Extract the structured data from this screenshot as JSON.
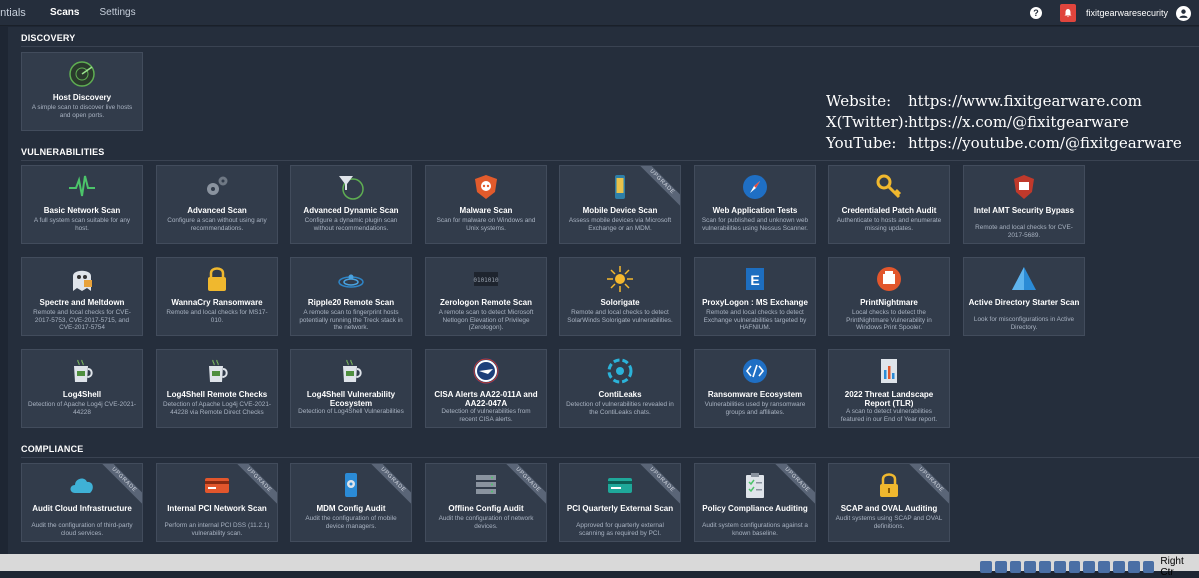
{
  "topbar": {
    "brand": "entials",
    "tabs": [
      "Scans",
      "Settings"
    ],
    "help": "?",
    "username": "fixitgearwaresecurity"
  },
  "overlay": {
    "lines": [
      {
        "label": "Website:",
        "value": "https://www.fixitgearware.com"
      },
      {
        "label": "X(Twitter):",
        "value": "https://x.com/@fixitgearware"
      },
      {
        "label": "YouTube:",
        "value": "https://youtube.com/@fixitgearware"
      }
    ]
  },
  "upgrade_label": "UPGRADE",
  "sections": [
    {
      "title": "DISCOVERY",
      "cards": [
        {
          "icon": "radar-icon",
          "title": "Host Discovery",
          "desc": "A simple scan to discover live hosts and open ports."
        }
      ]
    },
    {
      "title": "VULNERABILITIES",
      "cards": [
        {
          "icon": "pulse-icon",
          "title": "Basic Network Scan",
          "desc": "A full system scan suitable for any host."
        },
        {
          "icon": "gears-icon",
          "title": "Advanced Scan",
          "desc": "Configure a scan without using any recommendations."
        },
        {
          "icon": "funnel-radar-icon",
          "title": "Advanced Dynamic Scan",
          "desc": "Configure a dynamic plugin scan without recommendations."
        },
        {
          "icon": "skull-shield-icon",
          "title": "Malware Scan",
          "desc": "Scan for malware on Windows and Unix systems."
        },
        {
          "icon": "mobile-icon",
          "title": "Mobile Device Scan",
          "desc": "Assess mobile devices via Microsoft Exchange or an MDM.",
          "upgrade": true
        },
        {
          "icon": "compass-icon",
          "title": "Web Application Tests",
          "desc": "Scan for published and unknown web vulnerabilities using Nessus Scanner."
        },
        {
          "icon": "key-icon",
          "title": "Credentialed Patch Audit",
          "desc": "Authenticate to hosts and enumerate missing updates."
        },
        {
          "icon": "amt-shield-icon",
          "title": "Intel AMT Security Bypass",
          "desc": "Remote and local checks for CVE-2017-5689."
        },
        {
          "icon": "ghost-icon",
          "title": "Spectre and Meltdown",
          "desc": "Remote and local checks for CVE-2017-5753, CVE-2017-5715, and CVE-2017-5754"
        },
        {
          "icon": "padlock-icon",
          "title": "WannaCry Ransomware",
          "desc": "Remote and local checks for MS17-010."
        },
        {
          "icon": "ripple-icon",
          "title": "Ripple20 Remote Scan",
          "desc": "A remote scan to fingerprint hosts potentially running the Treck stack in the network."
        },
        {
          "icon": "zerologon-icon",
          "title": "Zerologon Remote Scan",
          "desc": "A remote scan to detect Microsoft Netlogon Elevation of Privilege (Zerologon)."
        },
        {
          "icon": "sun-icon",
          "title": "Solorigate",
          "desc": "Remote and local checks to detect SolarWinds Solorigate vulnerabilities."
        },
        {
          "icon": "exchange-icon",
          "title": "ProxyLogon : MS Exchange",
          "desc": "Remote and local checks to detect Exchange vulnerabilities targeted by HAFNIUM."
        },
        {
          "icon": "printer-icon",
          "title": "PrintNightmare",
          "desc": "Local checks to detect the PrintNightmare Vulnerability in Windows Print Spooler."
        },
        {
          "icon": "pyramid-icon",
          "title": "Active Directory Starter Scan",
          "desc": "Look for misconfigurations in Active Directory."
        },
        {
          "icon": "mug-icon",
          "title": "Log4Shell",
          "desc": "Detection of Apache Log4j CVE-2021-44228"
        },
        {
          "icon": "mug-icon",
          "title": "Log4Shell Remote Checks",
          "desc": "Detection of Apache Log4j CVE-2021-44228 via Remote Direct Checks"
        },
        {
          "icon": "mug-icon",
          "title": "Log4Shell Vulnerability Ecosystem",
          "desc": "Detection of Log4Shell Vulnerabilities"
        },
        {
          "icon": "eagle-icon",
          "title": "CISA Alerts AA22-011A and AA22-047A",
          "desc": "Detection of vulnerabilities from recent CISA alerts."
        },
        {
          "icon": "contileaks-icon",
          "title": "ContiLeaks",
          "desc": "Detection of vulnerabilities revealed in the ContiLeaks chats."
        },
        {
          "icon": "code-icon",
          "title": "Ransomware Ecosystem",
          "desc": "Vulnerabilities used by ransomware groups and affiliates."
        },
        {
          "icon": "report-icon",
          "title": "2022 Threat Landscape Report (TLR)",
          "desc": "A scan to detect vulnerabilities featured in our End of Year report."
        }
      ]
    },
    {
      "title": "COMPLIANCE",
      "cards": [
        {
          "icon": "cloud-icon",
          "title": "Audit Cloud Infrastructure",
          "desc": "Audit the configuration of third-party cloud services.",
          "upgrade": true
        },
        {
          "icon": "credit-card-icon",
          "title": "Internal PCI Network Scan",
          "desc": "Perform an internal PCI DSS (11.2.1) vulnerability scan.",
          "upgrade": true
        },
        {
          "icon": "mobile-gear-icon",
          "title": "MDM Config Audit",
          "desc": "Audit the configuration of mobile device managers.",
          "upgrade": true
        },
        {
          "icon": "server-icon",
          "title": "Offline Config Audit",
          "desc": "Audit the configuration of network devices.",
          "upgrade": true
        },
        {
          "icon": "card-icon",
          "title": "PCI Quarterly External Scan",
          "desc": "Approved for quarterly external scanning as required by PCI.",
          "upgrade": true
        },
        {
          "icon": "clipboard-icon",
          "title": "Policy Compliance Auditing",
          "desc": "Audit system configurations against a known baseline.",
          "upgrade": true
        },
        {
          "icon": "lock-icon",
          "title": "SCAP and OVAL Auditing",
          "desc": "Audit systems using SCAP and OVAL definitions.",
          "upgrade": true
        }
      ]
    }
  ],
  "taskbar": {
    "host_key": "Right Ctr"
  }
}
